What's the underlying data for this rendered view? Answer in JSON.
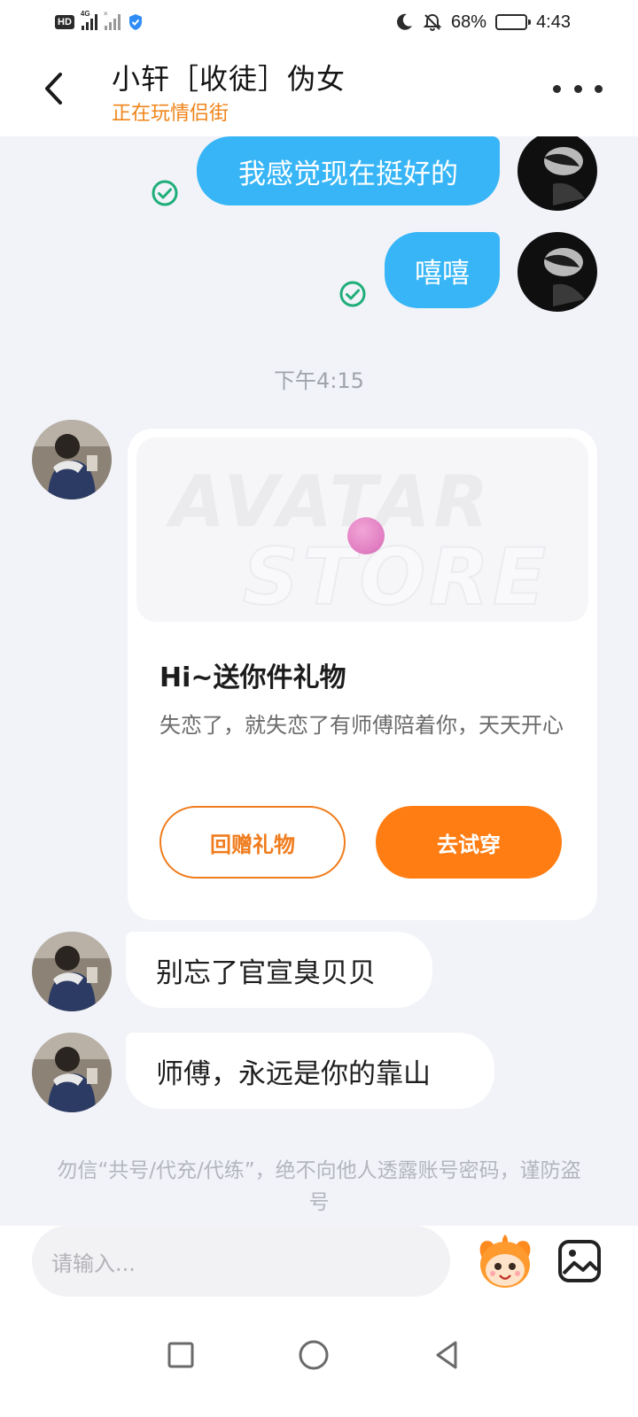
{
  "status_bar": {
    "hd_badge": "HD",
    "network_label": "4G",
    "sim2_mark": "×",
    "battery_percent_text": "68%",
    "battery_level": 0.68,
    "time": "4:43",
    "icons": [
      "moon-icon",
      "mute-bell-icon",
      "battery-icon",
      "shield-icon"
    ]
  },
  "header": {
    "title": "小轩［收徒］伪女",
    "subtitle": "正在玩情侣街",
    "back_icon": "chevron-left-icon",
    "more_icon": "more-dots-icon"
  },
  "chat": {
    "outgoing": [
      {
        "text": "我感觉现在挺好的",
        "status": "read"
      },
      {
        "text": "嘻嘻",
        "status": "read"
      }
    ],
    "timestamp": "下午4:15",
    "gift_card": {
      "banner_word_1": "AVATAR",
      "banner_word_2": "STORE",
      "title": "Hi~送你件礼物",
      "description": "失恋了，就失恋了有师傅陪着你，天天开心",
      "return_gift_label": "回赠礼物",
      "try_on_label": "去试穿"
    },
    "incoming": [
      {
        "text": "别忘了官宣臭贝贝"
      },
      {
        "text": "师傅，永远是你的靠山"
      }
    ],
    "safety_notice": "勿信“共号/代充/代练”，绝不向他人透露账号密码，谨防盗号"
  },
  "input_bar": {
    "placeholder": "请输入...",
    "emoji_icon": "mascot-emoji-icon",
    "image_icon": "image-icon"
  },
  "nav_bar": {
    "icons": [
      "recent-apps-icon",
      "home-icon",
      "back-triangle-icon"
    ]
  },
  "colors": {
    "accent_orange": "#ff7d12",
    "subtitle_orange": "#f08419",
    "bubble_blue": "#37b5f6",
    "read_check_green": "#1fae7a",
    "chat_background": "#f1f3f8"
  }
}
